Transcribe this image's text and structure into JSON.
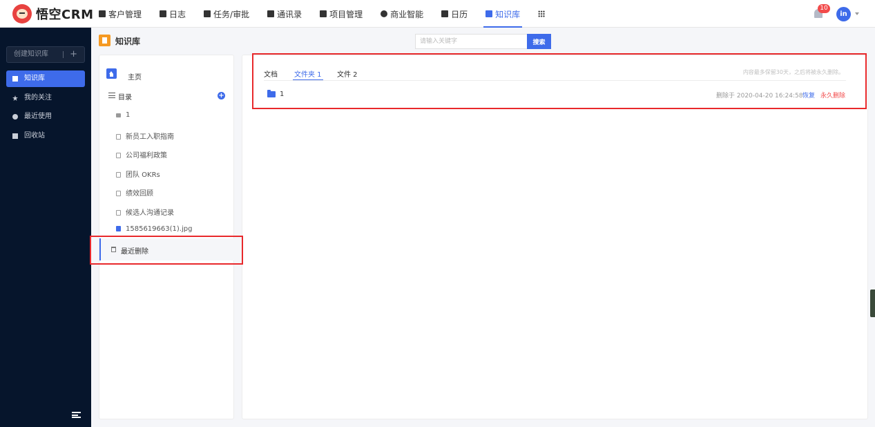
{
  "app": {
    "logo_text": "悟空CRM"
  },
  "nav": {
    "items": [
      {
        "label": "客户管理",
        "icon": "chart-icon"
      },
      {
        "label": "日志",
        "icon": "log-icon"
      },
      {
        "label": "任务/审批",
        "icon": "briefcase-icon"
      },
      {
        "label": "通讯录",
        "icon": "contacts-icon"
      },
      {
        "label": "项目管理",
        "icon": "project-icon"
      },
      {
        "label": "商业智能",
        "icon": "bi-icon"
      },
      {
        "label": "日历",
        "icon": "calendar-icon"
      },
      {
        "label": "知识库",
        "icon": "book-icon",
        "active": true
      }
    ]
  },
  "header": {
    "notification_count": "10",
    "avatar_text": "in"
  },
  "sidebar": {
    "create_label": "创建知识库",
    "create_plus": "+",
    "items": [
      {
        "label": "知识库",
        "icon": "book-icon",
        "active": true
      },
      {
        "label": "我的关注",
        "icon": "star-icon"
      },
      {
        "label": "最近使用",
        "icon": "clock-icon"
      },
      {
        "label": "回收站",
        "icon": "trash-icon"
      }
    ]
  },
  "page": {
    "title": "知识库",
    "search_placeholder": "请输入关键字",
    "search_button": "搜索"
  },
  "tree": {
    "home": "主页",
    "directory": "目录",
    "add": "+",
    "nodes": [
      {
        "label": "1",
        "type": "folder"
      },
      {
        "label": "新员工入职指南",
        "type": "doc"
      },
      {
        "label": "公司福利政策",
        "type": "doc"
      },
      {
        "label": "团队 OKRs",
        "type": "doc"
      },
      {
        "label": "绩效回顾",
        "type": "doc"
      },
      {
        "label": "候选人沟通记录",
        "type": "doc"
      },
      {
        "label": "1585619663(1).jpg",
        "type": "image"
      }
    ],
    "recently_deleted": "最近删除"
  },
  "content": {
    "tabs": [
      {
        "label": "文档"
      },
      {
        "label": "文件夹 1",
        "active": true
      },
      {
        "label": "文件 2"
      }
    ],
    "retention_note": "内容最多保留30天，之后将被永久删除。",
    "rows": [
      {
        "name": "1",
        "deleted_at": "删除于 2020-04-20 16:24:58",
        "restore": "恢复",
        "permanent_delete": "永久删除"
      }
    ]
  },
  "colors": {
    "accent": "#3e6bea",
    "sidebar_bg": "#06152c",
    "danger": "#f24a4a",
    "highlight": "#e8282b"
  }
}
